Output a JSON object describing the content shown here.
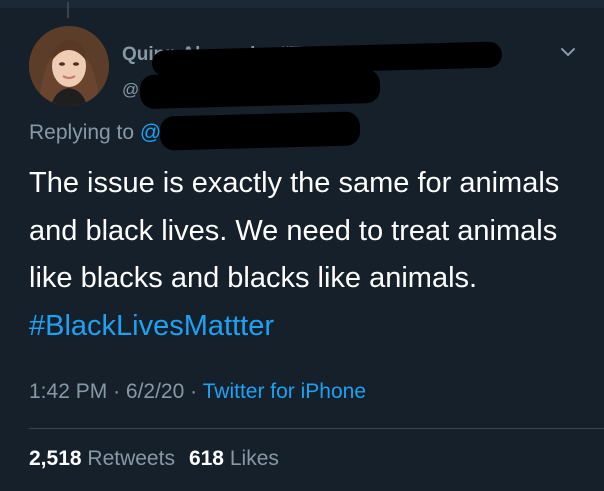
{
  "tweet": {
    "display_name": "Quinn Alexander #TransRights",
    "handle": "@Q",
    "replying_prefix": "Replying to",
    "replying_mention": "@",
    "text": "The issue is exactly the same for animals and black lives. We need to treat animals like blacks and blacks like animals.",
    "hashtag": "#BlackLivesMattter",
    "time": "1:42 PM",
    "separator": "·",
    "date": "6/2/20",
    "source": "Twitter for iPhone",
    "retweets_count": "2,518",
    "retweets_label": "Retweets",
    "likes_count": "618",
    "likes_label": "Likes"
  },
  "icons": {
    "menu": "chevron-down-icon",
    "avatar": "profile-photo"
  },
  "colors": {
    "background": "#15202b",
    "accent": "#1da1f2",
    "secondary_text": "#8899a6",
    "primary_text": "#ffffff",
    "divider": "#38444d",
    "redaction": "#000000"
  }
}
